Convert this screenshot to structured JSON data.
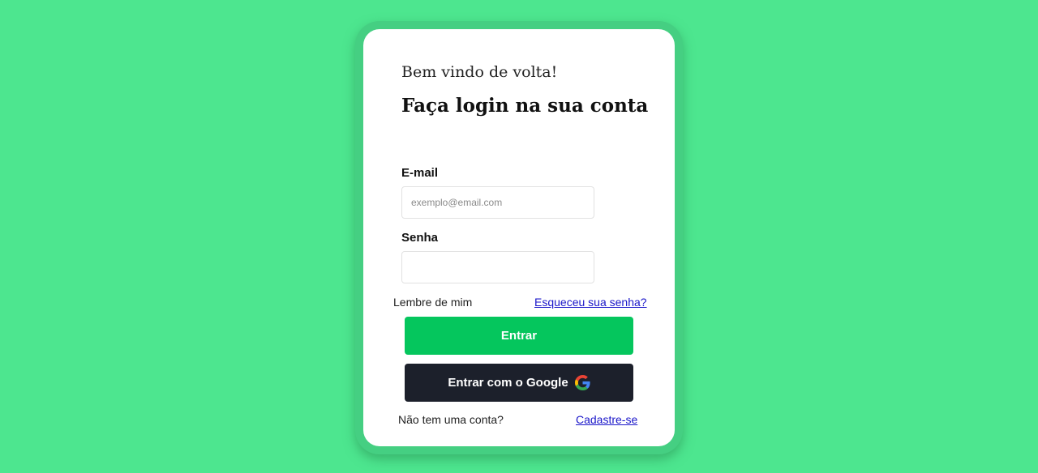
{
  "colors": {
    "background": "#4de68f",
    "card": "#ffffff",
    "primary_button": "#05c65d",
    "google_button": "#1c202b",
    "link": "#1a16c9"
  },
  "header": {
    "greeting": "Bem vindo de volta!",
    "title": "Faça login na sua conta"
  },
  "form": {
    "email_label": "E-mail",
    "email_placeholder": "exemplo@email.com",
    "email_value": "",
    "password_label": "Senha",
    "password_value": "",
    "remember_label": "Lembre de mim",
    "forgot_link": "Esqueceu sua senha?",
    "login_button": "Entrar",
    "google_button": "Entrar com o Google",
    "google_icon": "google-g-icon"
  },
  "footer": {
    "no_account_text": "Não tem uma conta?",
    "signup_link": "Cadastre-se"
  }
}
